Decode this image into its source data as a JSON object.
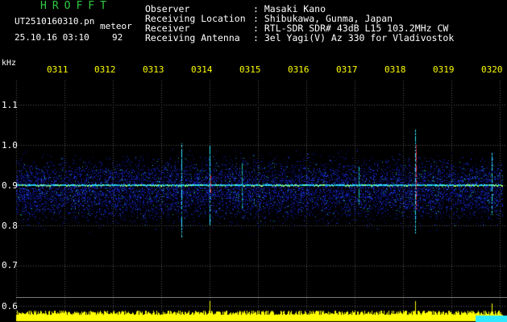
{
  "header": {
    "title": "HROFFT",
    "file_name": "UT2510160310.pn",
    "event_type": "meteor",
    "datetime": "25.10.16 03:10",
    "count": "92"
  },
  "info": [
    {
      "label": "Observer",
      "value": ": Masaki Kano"
    },
    {
      "label": "Receiving Location",
      "value": ": Shibukawa, Gunma, Japan"
    },
    {
      "label": "Receiver",
      "value": ": RTL-SDR SDR# 43dB L15 103.2MHz CW"
    },
    {
      "label": "Receiving Antenna",
      "value": ": 3el Yagi(V) Az 330 for Vladivostok"
    }
  ],
  "axis": {
    "unit_label": "kHz",
    "time_ticks": [
      "0311",
      "0312",
      "0313",
      "0314",
      "0315",
      "0316",
      "0317",
      "0318",
      "0319",
      "0320"
    ],
    "freq_ticks": [
      "1.1",
      "1.0",
      "0.9",
      "0.8",
      "0.7",
      "0.6"
    ]
  },
  "colors": {
    "background": "#000000",
    "title": "#2ecc40",
    "ticks": "#ffff00",
    "noise_band": "#1a2fd6",
    "carrier": "#2ee8ff",
    "meteor": "#ff2040",
    "power_bar": "#ffff00"
  }
}
